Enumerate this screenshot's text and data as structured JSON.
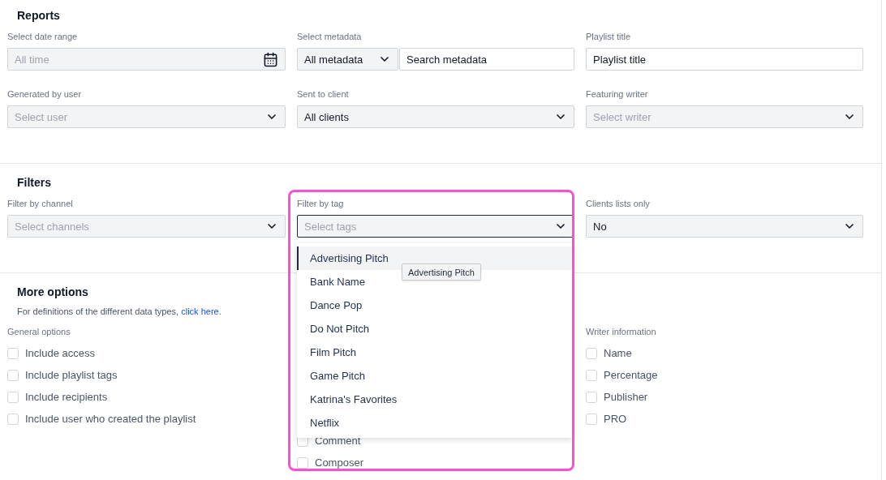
{
  "reports": {
    "title": "Reports",
    "fields": [
      {
        "kind": "date",
        "label": "Select date range",
        "placeholder": "All time"
      },
      {
        "kind": "combo",
        "label": "Select metadata",
        "select_value": "All metadata",
        "search_value": "Search metadata"
      },
      {
        "kind": "text",
        "label": "Playlist title",
        "value": "Playlist title"
      },
      {
        "kind": "select",
        "label": "Generated by user",
        "placeholder": "Select user"
      },
      {
        "kind": "select",
        "label": "Sent to client",
        "value": "All clients"
      },
      {
        "kind": "select",
        "label": "Featuring writer",
        "placeholder": "Select writer"
      }
    ]
  },
  "filters": {
    "title": "Filters",
    "fields": [
      {
        "kind": "select",
        "label": "Filter by channel",
        "placeholder": "Select channels",
        "focused": false
      },
      {
        "kind": "select",
        "label": "Filter by tag",
        "placeholder": "Select tags",
        "focused": true,
        "expanded": true
      },
      {
        "kind": "select",
        "label": "Clients lists only",
        "value": "No",
        "focused": false
      }
    ]
  },
  "tag_menu": {
    "options": [
      {
        "label": "Advertising Pitch",
        "selected": true
      },
      {
        "label": "Bank Name",
        "selected": false
      },
      {
        "label": "Dance Pop",
        "selected": false
      },
      {
        "label": "Do Not Pitch",
        "selected": false
      },
      {
        "label": "Film Pitch",
        "selected": false
      },
      {
        "label": "Game Pitch",
        "selected": false
      },
      {
        "label": "Katrina's Favorites",
        "selected": false
      },
      {
        "label": "Netflix",
        "selected": false
      }
    ],
    "tooltip": "Advertising Pitch"
  },
  "more_options": {
    "title": "More options",
    "description": {
      "text": "For definitions of the different data types, ",
      "link": "click here",
      "after": "."
    },
    "groups": [
      {
        "label": "General options",
        "options": [
          {
            "label": "Include access",
            "checked": false
          },
          {
            "label": "Include playlist tags",
            "checked": false
          },
          {
            "label": "Include recipients",
            "checked": false
          },
          {
            "label": "Include user who created the playlist",
            "checked": false
          }
        ]
      },
      {
        "options": [
          {
            "label": "Comment",
            "checked": false
          },
          {
            "label": "Composer",
            "checked": false
          }
        ]
      },
      {
        "label": "Writer information",
        "options": [
          {
            "label": "Name",
            "checked": false
          },
          {
            "label": "Percentage",
            "checked": false
          },
          {
            "label": "Publisher",
            "checked": false
          },
          {
            "label": "PRO",
            "checked": false
          }
        ]
      }
    ]
  },
  "highlight_box": true
}
